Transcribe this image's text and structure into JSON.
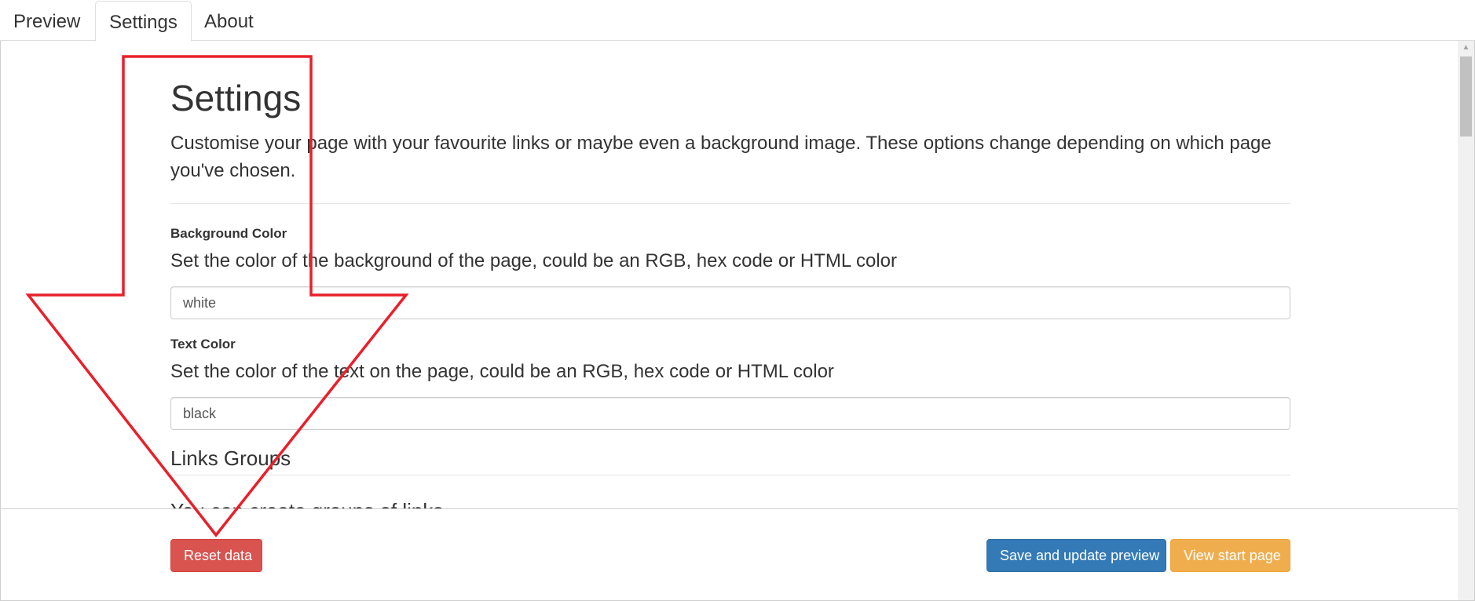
{
  "tabs": [
    {
      "label": "Preview",
      "active": false
    },
    {
      "label": "Settings",
      "active": true
    },
    {
      "label": "About",
      "active": false
    }
  ],
  "settings": {
    "title": "Settings",
    "lead": "Customise your page with your favourite links or maybe even a background image. These options change depending on which page you've chosen.",
    "background_color": {
      "label": "Background Color",
      "help": "Set the color of the background of the page, could be an RGB, hex code or HTML color",
      "value": "white"
    },
    "text_color": {
      "label": "Text Color",
      "help": "Set the color of the text on the page, could be an RGB, hex code or HTML color",
      "value": "black"
    },
    "links_groups": {
      "heading": "Links Groups",
      "partial_text": "You can create groups of links"
    }
  },
  "footer": {
    "reset_label": "Reset data",
    "save_label": "Save and update preview",
    "view_label": "View start page"
  },
  "colors": {
    "danger": "#d9534f",
    "primary": "#337ab7",
    "warning": "#f0ad4e",
    "annotation_arrow": "#e8202a"
  },
  "icons": {
    "annotation": "down-arrow-outline-icon",
    "scroll_up": "chevron-up-icon"
  }
}
